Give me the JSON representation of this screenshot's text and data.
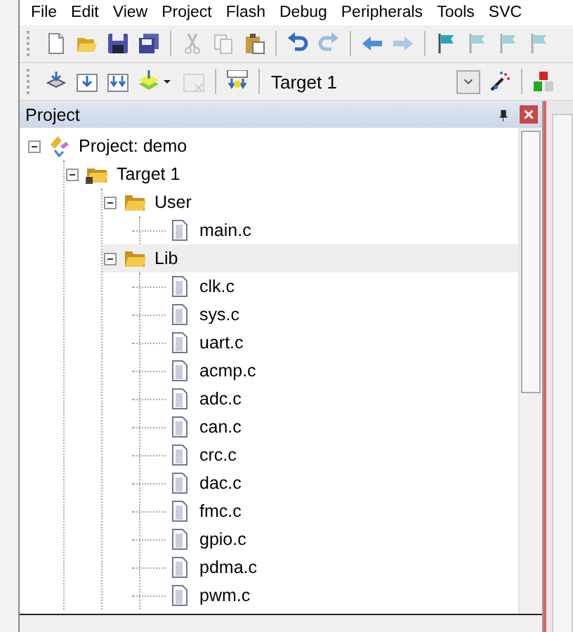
{
  "menu": [
    "File",
    "Edit",
    "View",
    "Project",
    "Flash",
    "Debug",
    "Peripherals",
    "Tools",
    "SVC"
  ],
  "toolbar": [
    {
      "kind": "new",
      "disabled": false
    },
    {
      "kind": "open",
      "disabled": false
    },
    {
      "kind": "save",
      "disabled": false
    },
    {
      "kind": "saveall",
      "disabled": false
    },
    {
      "kind": "sep"
    },
    {
      "kind": "cut",
      "disabled": true
    },
    {
      "kind": "copy",
      "disabled": true
    },
    {
      "kind": "paste",
      "disabled": false
    },
    {
      "kind": "sep"
    },
    {
      "kind": "undo",
      "disabled": false
    },
    {
      "kind": "redo",
      "disabled": true
    },
    {
      "kind": "sep"
    },
    {
      "kind": "back",
      "disabled": false
    },
    {
      "kind": "forward",
      "disabled": true
    },
    {
      "kind": "sep"
    },
    {
      "kind": "bookmark",
      "disabled": false
    },
    {
      "kind": "bookmark",
      "disabled": true
    },
    {
      "kind": "bookmark",
      "disabled": true
    },
    {
      "kind": "bookmark",
      "disabled": true
    }
  ],
  "build_toolbar": {
    "target": "Target 1"
  },
  "panel": {
    "title": "Project"
  },
  "tree": [
    {
      "kind": "project",
      "label": "Project: demo",
      "expanded": true,
      "selected": false,
      "children": [
        {
          "kind": "target",
          "label": "Target 1",
          "expanded": true,
          "selected": false,
          "children": [
            {
              "kind": "folder",
              "label": "User",
              "expanded": true,
              "selected": false,
              "children": [
                {
                  "kind": "file",
                  "label": "main.c",
                  "selected": false
                }
              ]
            },
            {
              "kind": "folder",
              "label": "Lib",
              "expanded": true,
              "selected": true,
              "children": [
                {
                  "kind": "file",
                  "label": "clk.c",
                  "selected": false
                },
                {
                  "kind": "file",
                  "label": "sys.c",
                  "selected": false
                },
                {
                  "kind": "file",
                  "label": "uart.c",
                  "selected": false
                },
                {
                  "kind": "file",
                  "label": "acmp.c",
                  "selected": false
                },
                {
                  "kind": "file",
                  "label": "adc.c",
                  "selected": false
                },
                {
                  "kind": "file",
                  "label": "can.c",
                  "selected": false
                },
                {
                  "kind": "file",
                  "label": "crc.c",
                  "selected": false
                },
                {
                  "kind": "file",
                  "label": "dac.c",
                  "selected": false
                },
                {
                  "kind": "file",
                  "label": "fmc.c",
                  "selected": false
                },
                {
                  "kind": "file",
                  "label": "gpio.c",
                  "selected": false
                },
                {
                  "kind": "file",
                  "label": "pdma.c",
                  "selected": false
                },
                {
                  "kind": "file",
                  "label": "pwm.c",
                  "selected": false
                }
              ]
            }
          ]
        }
      ]
    }
  ]
}
